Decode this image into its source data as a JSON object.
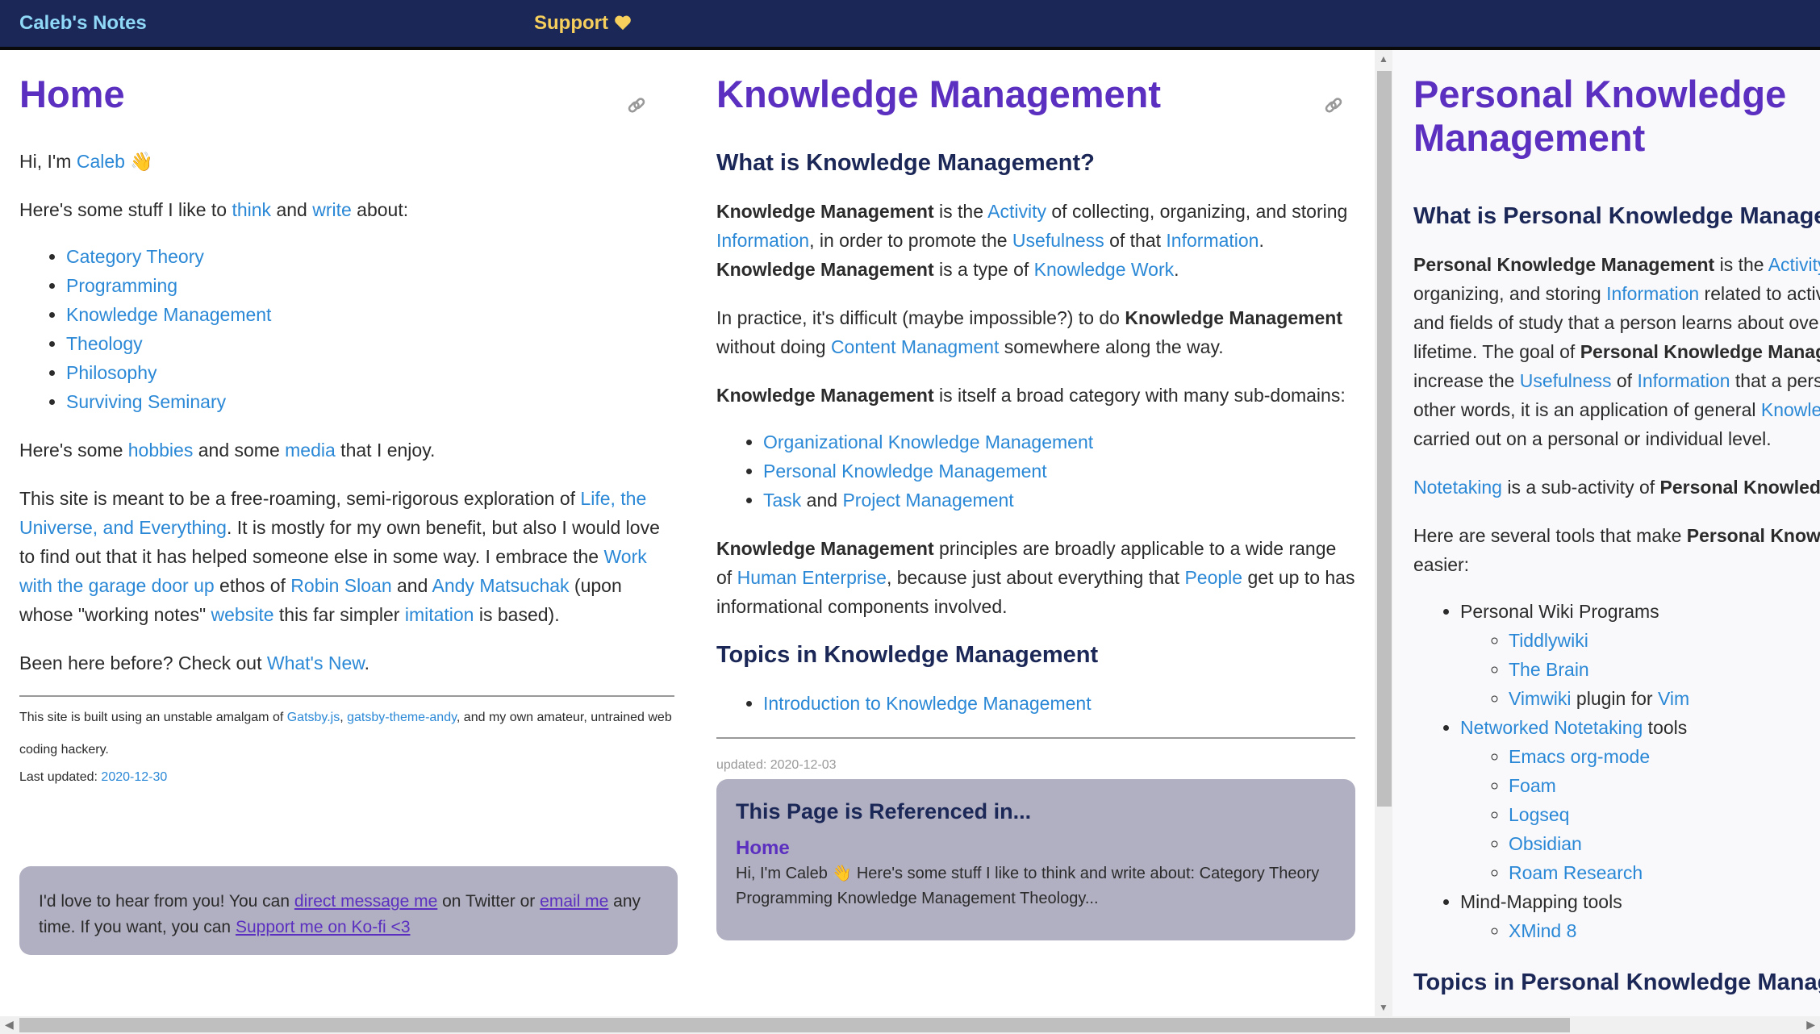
{
  "header": {
    "brand": "Caleb's Notes",
    "support_label": "Support",
    "support_icon": "heart-icon"
  },
  "home": {
    "title": "Home",
    "greeting": {
      "pre": "Hi, I'm ",
      "link": "Caleb",
      "emoji": "👋"
    },
    "intro": {
      "pre": "Here's some stuff I like to ",
      "link1": "think",
      "mid": " and ",
      "link2": "write",
      "post": " about:"
    },
    "topics": [
      "Category Theory",
      "Programming",
      "Knowledge Management",
      "Theology",
      "Philosophy",
      "Surviving Seminary"
    ],
    "hobbies": {
      "pre": "Here's some ",
      "link1": "hobbies",
      "mid": " and some ",
      "link2": "media",
      "post": " that I enjoy."
    },
    "about": {
      "t1": "This site is meant to be a free-roaming, semi-rigorous exploration of ",
      "l1": "Life, the Universe, and Everything",
      "t2": ". It is mostly for my own benefit, but also I would love to find out that it has helped someone else in some way. I embrace the ",
      "l2": "Work with the garage door up",
      "t3": " ethos of ",
      "l3": "Robin Sloan",
      "t4": " and ",
      "l4": "Andy Matsuchak",
      "t5": " (upon whose \"working notes\" ",
      "l5": "website",
      "t6": " this far simpler ",
      "l6": "imitation",
      "t7": " is based)."
    },
    "been_here": {
      "pre": "Been here before? Check out ",
      "link": "What's New",
      "post": "."
    },
    "footer": {
      "pre": "This site is built using an unstable amalgam of ",
      "l1": "Gatsby.js",
      "mid": ", ",
      "l2": "gatsby-theme-andy",
      "post": ", and my own amateur, untrained web coding hackery.",
      "updated_label": "Last updated: ",
      "updated_date": "2020-12-30"
    },
    "contact": {
      "t1": "I'd love to hear from you! You can ",
      "l1": "direct message me",
      "t2": " on Twitter or ",
      "l2": "email me",
      "t3": " any time. If you want, you can ",
      "l3": "Support me on Ko-fi <3"
    }
  },
  "km": {
    "title": "Knowledge Management",
    "h_what": "What is Knowledge Management?",
    "p1": {
      "b1": "Knowledge Management",
      "t1": " is the ",
      "l1": "Activity",
      "t2": " of collecting, organizing, and storing ",
      "l2": "Information",
      "t3": ", in order to promote the ",
      "l3": "Usefulness",
      "t4": " of that ",
      "l4": "Information",
      "t5": ". ",
      "b2": "Knowledge Management",
      "t6": " is a type of ",
      "l5": "Knowledge Work",
      "t7": "."
    },
    "p2": {
      "t1": "In practice, it's difficult (maybe impossible?) to do ",
      "b1": "Knowledge Management",
      "t2": " without doing ",
      "l1": "Content Managment",
      "t3": " somewhere along the way."
    },
    "p3": {
      "b1": "Knowledge Management",
      "t1": " is itself a broad category with many sub-domains:"
    },
    "subdomains": {
      "item1": "Organizational Knowledge Management",
      "item2": "Personal Knowledge Management",
      "item3_l1": "Task",
      "item3_mid": " and ",
      "item3_l2": "Project Management"
    },
    "p4": {
      "b1": "Knowledge Management",
      "t1": " principles are broadly applicable to a wide range of ",
      "l1": "Human Enterprise",
      "t2": ", because just about everything that ",
      "l2": "People",
      "t3": " get up to has informational components involved."
    },
    "h_topics": "Topics in Knowledge Management",
    "topics": [
      "Introduction to Knowledge Management"
    ],
    "updated": "updated: 2020-12-03",
    "refs": {
      "heading": "This Page is Referenced in...",
      "title": "Home",
      "snippet": "Hi, I'm Caleb 👋 Here's some stuff I like to think and write about: Category Theory Programming Knowledge Management Theology..."
    }
  },
  "pkm": {
    "title": "Personal Knowledge Management",
    "h_what": "What is Personal Knowledge Management?",
    "p1": {
      "b1": "Personal Knowledge Management",
      "t1": " is the ",
      "l1": "Activity",
      "t2": " of collecting, organizing, and storing ",
      "l2": "Information",
      "t3": " related to activities, experiences, and fields of study that a person learns about over the course of a lifetime. The goal of ",
      "b2": "Personal Knowledge Management",
      "t4": " is to increase the ",
      "l3": "Usefulness",
      "t5": " of ",
      "l4": "Information",
      "t6": " that a person has access to. In other words, it is an application of general ",
      "l5": "Knowledge Management",
      "t7": " carried out on a personal or individual level."
    },
    "p2": {
      "l1": "Notetaking",
      "t1": " is a sub-activity of ",
      "b1": "Personal Knowledge Management",
      "t2": "."
    },
    "p3": {
      "t1": "Here are several tools that make ",
      "b1": "Personal Knowledge Management",
      "t2": " easier:"
    },
    "tools": {
      "g1": "Personal Wiki Programs",
      "g1_items": [
        "Tiddlywiki",
        "The Brain"
      ],
      "g1_vim": {
        "l1": "Vimwiki",
        "t1": " plugin for ",
        "l2": "Vim"
      },
      "g2_link": "Networked Notetaking",
      "g2_post": " tools",
      "g2_items": [
        "Emacs org-mode",
        "Foam",
        "Logseq",
        "Obsidian",
        "Roam Research"
      ],
      "g3": "Mind-Mapping tools",
      "g3_items": [
        "XMind 8"
      ]
    },
    "h_topics": "Topics in Personal Knowledge Management"
  }
}
